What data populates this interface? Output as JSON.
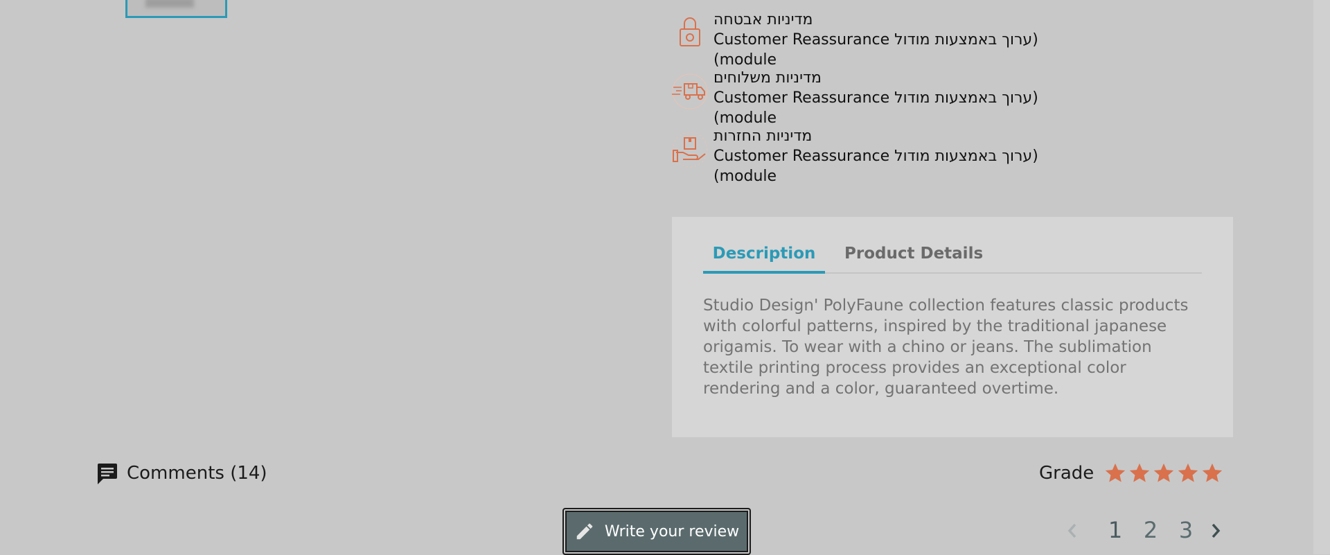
{
  "reassurance": {
    "items": [
      {
        "icon": "padlock-icon",
        "title": "מדיניות אבטחה",
        "subtitle": "(ערוך באמצעות מודול Customer Reassurance module)"
      },
      {
        "icon": "delivery-truck-icon",
        "title": "מדיניות משלוחים",
        "subtitle": "(ערוך באמצעות מודול Customer Reassurance module)"
      },
      {
        "icon": "package-return-icon",
        "title": "מדיניות החזרות",
        "subtitle": "(ערוך באמצעות מודול Customer Reassurance module)"
      }
    ]
  },
  "tabs": {
    "description_label": "Description",
    "details_label": "Product Details"
  },
  "description": {
    "text": "Studio Design' PolyFaune collection features classic products with colorful patterns, inspired by the traditional japanese origamis. To wear with a chino or jeans. The sublimation textile printing process provides an exceptional color rendering and a color, guaranteed overtime."
  },
  "comments": {
    "label": "Comments (14)"
  },
  "grade": {
    "label": "Grade",
    "stars": 5,
    "max": 5
  },
  "write_review": {
    "label": "Write your review"
  },
  "pagination": {
    "pages": [
      "1",
      "2",
      "3"
    ],
    "current": "1"
  },
  "colors": {
    "accent": "#2b9ab6",
    "icon_orange": "#d9714c",
    "star": "#d9714c",
    "button_bg": "#5b6b6d"
  }
}
